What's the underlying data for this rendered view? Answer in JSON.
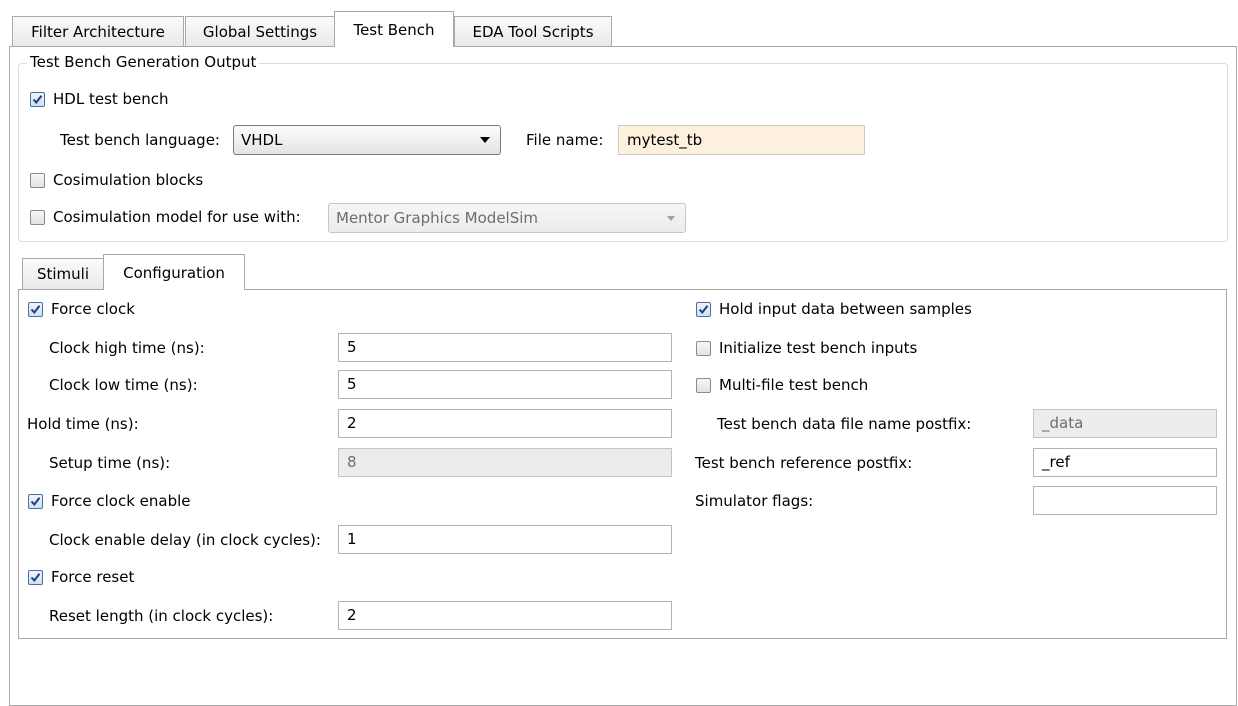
{
  "main_tabs": [
    {
      "label": "Filter Architecture",
      "active": false
    },
    {
      "label": "Global Settings",
      "active": false
    },
    {
      "label": "Test Bench",
      "active": true
    },
    {
      "label": "EDA Tool Scripts",
      "active": false
    }
  ],
  "output_group": {
    "title": "Test Bench Generation Output",
    "hdl_test_bench": {
      "label": "HDL test bench",
      "checked": true
    },
    "language": {
      "label": "Test bench language:",
      "value": "VHDL"
    },
    "file_name": {
      "label": "File name:",
      "value": "mytest_tb"
    },
    "cosim_blocks": {
      "label": "Cosimulation blocks",
      "checked": false
    },
    "cosim_model": {
      "label": "Cosimulation model for use with:",
      "checked": false,
      "value": "Mentor Graphics ModelSim"
    }
  },
  "sub_tabs": [
    {
      "label": "Stimuli",
      "active": false
    },
    {
      "label": "Configuration",
      "active": true
    }
  ],
  "config": {
    "force_clock": {
      "label": "Force clock",
      "checked": true
    },
    "clock_high": {
      "label": "Clock high time (ns):",
      "value": "5"
    },
    "clock_low": {
      "label": "Clock low time (ns):",
      "value": "5"
    },
    "hold_time": {
      "label": "Hold time (ns):",
      "value": "2"
    },
    "setup_time": {
      "label": "Setup time (ns):",
      "value": "8"
    },
    "force_clock_enable": {
      "label": "Force clock enable",
      "checked": true
    },
    "clock_enable_delay": {
      "label": "Clock enable delay (in clock cycles):",
      "value": "1"
    },
    "force_reset": {
      "label": "Force reset",
      "checked": true
    },
    "reset_length": {
      "label": "Reset length (in clock cycles):",
      "value": "2"
    },
    "hold_input": {
      "label": "Hold input data between samples",
      "checked": true
    },
    "init_inputs": {
      "label": "Initialize test bench inputs",
      "checked": false
    },
    "multi_file": {
      "label": "Multi-file test bench",
      "checked": false
    },
    "data_postfix": {
      "label": "Test bench data file name postfix:",
      "value": "_data"
    },
    "ref_postfix": {
      "label": "Test bench reference postfix:",
      "value": "_ref"
    },
    "sim_flags": {
      "label": "Simulator flags:",
      "value": ""
    }
  }
}
